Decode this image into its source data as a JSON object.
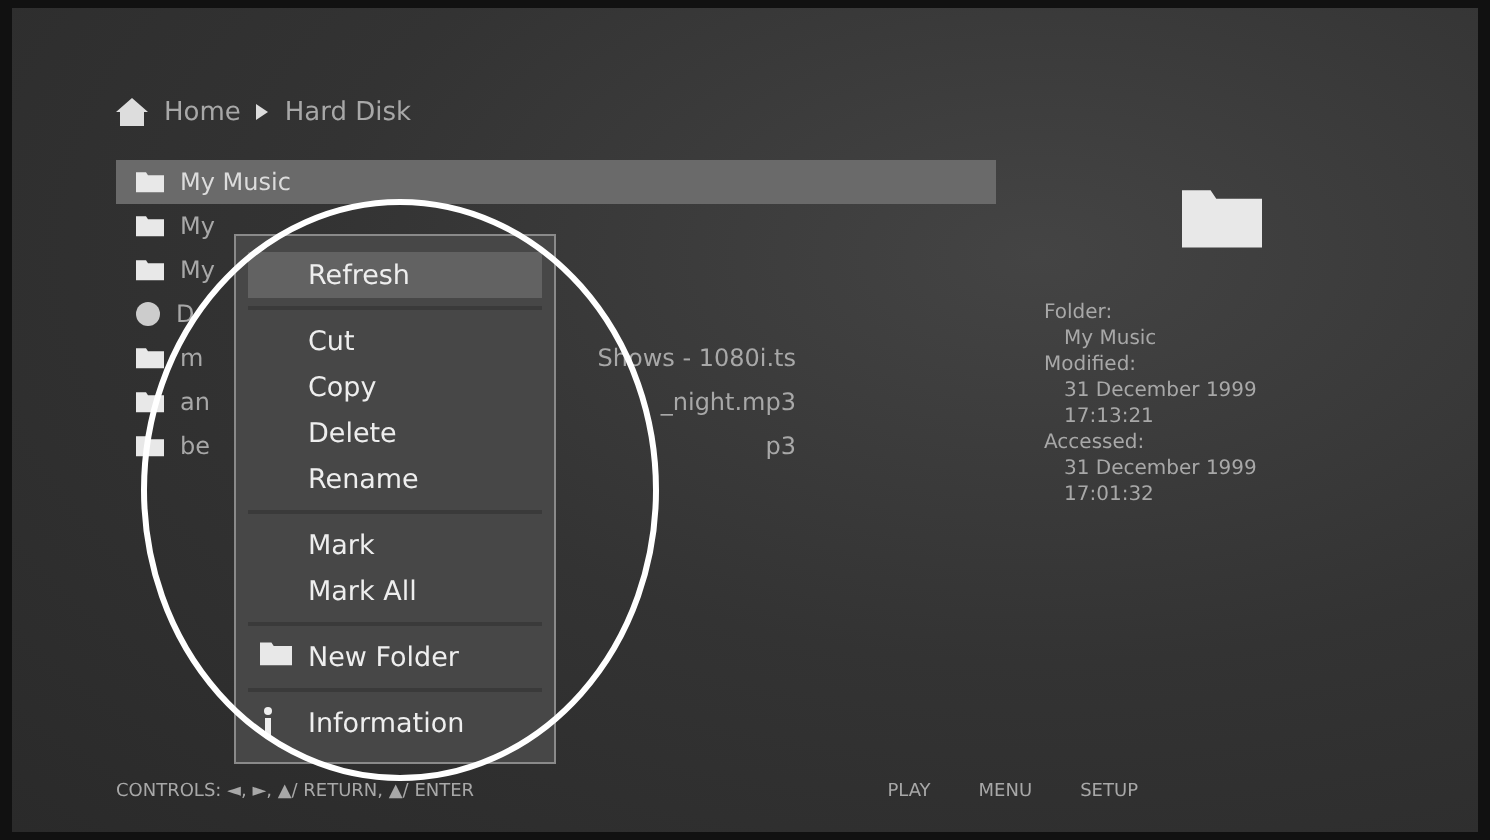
{
  "breadcrumb": [
    "Home",
    "Hard Disk"
  ],
  "files": [
    {
      "name": "My Music",
      "kind": "folder",
      "selected": true
    },
    {
      "name": "My",
      "kind": "folder",
      "selected": false
    },
    {
      "name": "My",
      "kind": "folder",
      "selected": false
    },
    {
      "name": "D",
      "kind": "disc",
      "selected": false
    },
    {
      "name": "m",
      "kind": "folder",
      "selected": false,
      "tail": "Shows - 1080i.ts"
    },
    {
      "name": "an",
      "kind": "folder",
      "selected": false,
      "tail": "_night.mp3"
    },
    {
      "name": "be",
      "kind": "folder",
      "selected": false,
      "tail": "p3"
    }
  ],
  "context_menu": [
    [
      {
        "label": "Refresh",
        "selected": true
      }
    ],
    [
      {
        "label": "Cut",
        "selected": false
      },
      {
        "label": "Copy",
        "selected": false
      },
      {
        "label": "Delete",
        "selected": false
      },
      {
        "label": "Rename",
        "selected": false
      }
    ],
    [
      {
        "label": "Mark",
        "selected": false
      },
      {
        "label": "Mark  All",
        "selected": false
      }
    ],
    [
      {
        "label": "New  Folder",
        "selected": false,
        "kind": "folder"
      }
    ],
    [
      {
        "label": "Information",
        "selected": false,
        "kind": "info"
      }
    ]
  ],
  "info_panel": [
    {
      "label": "Folder:",
      "value": [
        "My Music"
      ]
    },
    {
      "label": "Modified:",
      "value": [
        "31 December 1999",
        "17:13:21"
      ]
    },
    {
      "label": "Accessed:",
      "value": [
        "31 December 1999",
        "17:01:32"
      ]
    }
  ],
  "footer": {
    "controls": "CONTROLS:  ◄, ►, ▲/ RETURN, ▲/ ENTER",
    "buttons": [
      "PLAY",
      "MENU",
      "SETUP"
    ]
  }
}
